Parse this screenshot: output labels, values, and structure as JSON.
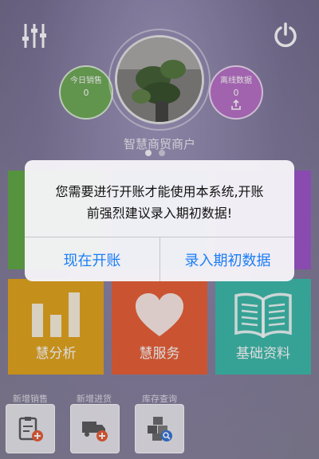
{
  "header": {
    "today_sales": {
      "label": "今日销售",
      "value": "0"
    },
    "offline_data": {
      "label": "离线数据",
      "value": "0"
    },
    "store_name": "智慧商贸商户",
    "page_indicator": {
      "count": 2,
      "active": 1
    }
  },
  "tiles": {
    "analysis": "慧分析",
    "service": "慧服务",
    "basic_data": "基础资料"
  },
  "quick_actions": {
    "new_sale": "新增销售",
    "new_purchase": "新增进货",
    "stock_query": "库存查询"
  },
  "dialog": {
    "message_line1": "您需要进行开账才能使用本系统,开账",
    "message_line2": "前强烈建议录入期初数据!",
    "left_button": "现在开账",
    "right_button": "录入期初数据"
  },
  "colors": {
    "accent": "#1b7ef5",
    "green": "#5ca63c",
    "purple": "#9a4fc7",
    "orange": "#e3a112",
    "red": "#e95a2d",
    "teal": "#35b9a6"
  }
}
